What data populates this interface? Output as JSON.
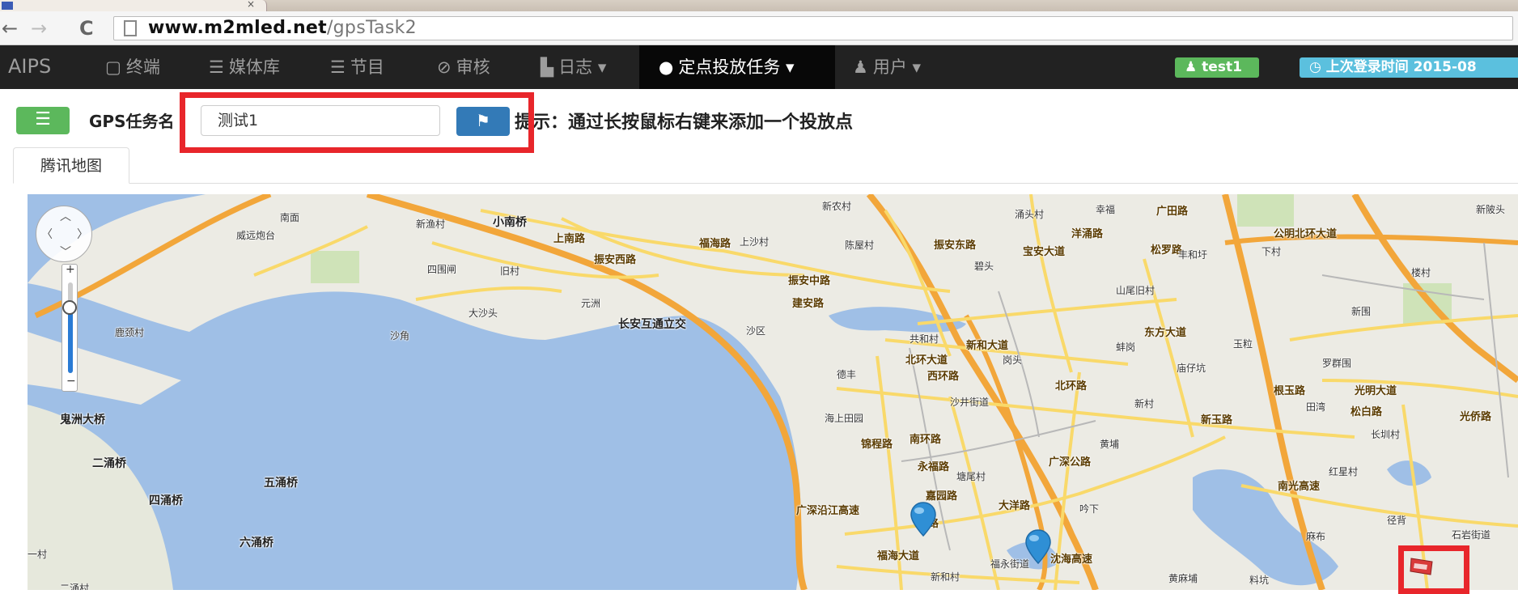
{
  "browser": {
    "url_host": "www.m2mled.net",
    "url_path": "/gpsTask2"
  },
  "navbar": {
    "brand": "AIPS",
    "items": [
      {
        "icon": "terminal-icon",
        "label": "终端"
      },
      {
        "icon": "media-icon",
        "label": "媒体库"
      },
      {
        "icon": "program-icon",
        "label": "节目"
      },
      {
        "icon": "check-circle-icon",
        "label": "审核"
      },
      {
        "icon": "document-icon",
        "label": "日志"
      },
      {
        "icon": "globe-icon",
        "label": "定点投放任务"
      },
      {
        "icon": "user-icon",
        "label": "用户"
      }
    ],
    "user_badge": "test1",
    "last_login": "上次登录时间  2015-08"
  },
  "toolbar": {
    "task_label": "GPS任务名",
    "task_name_value": "测试1",
    "hint": "提示：通过长按鼠标右键来添加一个投放点"
  },
  "tabs": {
    "map_tab": "腾讯地图"
  },
  "map": {
    "labels": {
      "l1": "小南桥",
      "l2": "新农村",
      "l3": "涌头村",
      "l4": "幸福",
      "l5": "广田路",
      "l6": "公明北环大道",
      "l7": "新陂头",
      "l8": "南面",
      "l9": "新渔村",
      "l10": "上南路",
      "l11": "威远炮台",
      "l12": "福海路",
      "l13": "上沙村",
      "l14": "陈屋村",
      "l15": "振安东路",
      "l16": "宝安大道",
      "l17": "洋涌路",
      "l18": "松罗路",
      "l19": "丰和圩",
      "l20": "下村",
      "l21": "四围闸",
      "l22": "旧村",
      "l23": "振安西路",
      "l24": "振安中路",
      "l25": "碧头",
      "l26": "山尾旧村",
      "l27": "楼村",
      "l28": "大沙头",
      "l29": "元洲",
      "l30": "建安路",
      "l31": "新围",
      "l32": "鹿颈村",
      "l33": "长安互通立交",
      "l34": "沙区",
      "l35": "沙角",
      "l36": "东方大道",
      "l37": "共和村",
      "l38": "新和大道",
      "l39": "蚌岗",
      "l40": "玉粒",
      "l41": "北环大道",
      "l42": "岗头",
      "l43": "庙仔坑",
      "l44": "罗群围",
      "l45": "德丰",
      "l46": "西环路",
      "l47": "沙井街道",
      "l48": "北环路",
      "l49": "新村",
      "l50": "根玉路",
      "l51": "光明大道",
      "l52": "田湾",
      "l53": "松白路",
      "l54": "光侨路",
      "l55": "鬼洲大桥",
      "l56": "海上田园",
      "l57": "新玉路",
      "l58": "长圳村",
      "l59": "南环路",
      "l60": "锦程路",
      "l61": "黄埔",
      "l62": "永福路",
      "l63": "塘尾村",
      "l64": "广深公路",
      "l65": "红星村",
      "l66": "二涌桥",
      "l67": "五涌桥",
      "l68": "嘉园路",
      "l69": "四涌桥",
      "l70": "大洋路",
      "l71": "南光高速",
      "l72": "广深沿江高速",
      "l73": "六涌桥",
      "l74": "福海大道",
      "l75": "福永街道",
      "l76": "麻布",
      "l77": "径背",
      "l78": "石岩街道",
      "l79": "新和村",
      "l80": "黄麻埔",
      "l81": "料坑",
      "l82": "一村",
      "l83": "沈海高速",
      "l84": "和路",
      "l85": "吟下",
      "l86": "二涌村"
    }
  }
}
